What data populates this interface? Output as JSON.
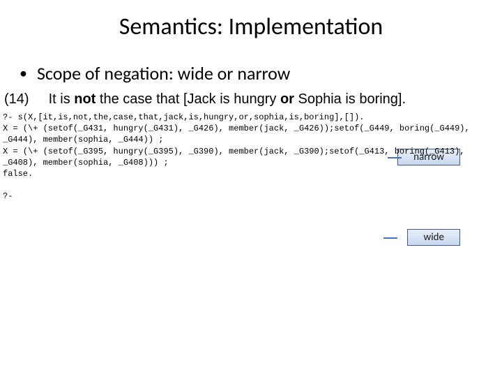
{
  "title": "Semantics: Implementation",
  "bullet": "Scope of negation: wide or narrow",
  "example": {
    "num": "(14)",
    "lead": "It is ",
    "boldA": "not",
    "mid": " the case that [Jack is hungry ",
    "boldB": "or",
    "tail": " Sophia is boring]."
  },
  "labels": {
    "narrow": "narrow",
    "wide": "wide"
  },
  "code": {
    "l1": "?- s(X,[it,is,not,the,case,that,jack,is,hungry,or,sophia,is,boring],[]).",
    "l2": "X = (\\+ (setof(_G431, hungry(_G431), _G426), member(jack, _G426));setof(_G449, boring(_G449),",
    "l3": "_G444), member(sophia, _G444)) ;",
    "l4": "X = (\\+ (setof(_G395, hungry(_G395), _G390), member(jack, _G390);setof(_G413, boring(_G413),",
    "l5": "_G408), member(sophia, _G408))) ;",
    "l6": "false.",
    "l7": "",
    "l8": "?- "
  }
}
